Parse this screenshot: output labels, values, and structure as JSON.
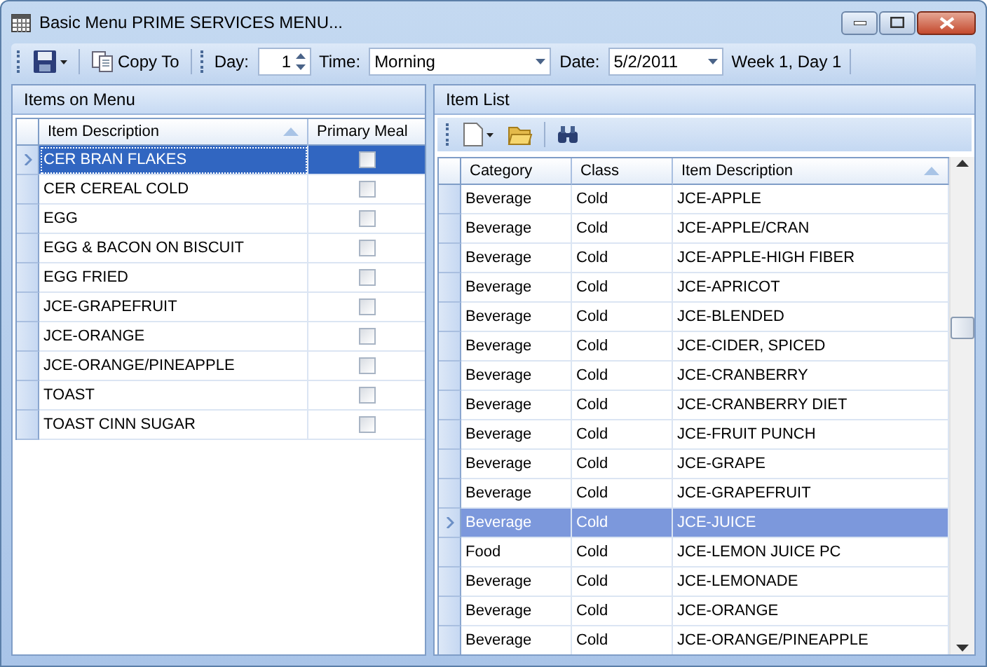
{
  "window": {
    "title": "Basic Menu PRIME SERVICES MENU..."
  },
  "toolbar": {
    "copy_to": "Copy To",
    "day_label": "Day:",
    "day_value": "1",
    "time_label": "Time:",
    "time_value": "Morning",
    "date_label": "Date:",
    "date_value": "5/2/2011",
    "week": "Week 1, Day 1"
  },
  "items_on_menu": {
    "title": "Items on Menu",
    "columns": [
      "Item Description",
      "Primary Meal"
    ],
    "rows": [
      {
        "description": "CER BRAN FLAKES",
        "primary_meal": false,
        "selected": true
      },
      {
        "description": "CER CEREAL COLD",
        "primary_meal": false,
        "selected": false
      },
      {
        "description": "EGG",
        "primary_meal": false,
        "selected": false
      },
      {
        "description": "EGG & BACON ON BISCUIT",
        "primary_meal": false,
        "selected": false
      },
      {
        "description": "EGG FRIED",
        "primary_meal": false,
        "selected": false
      },
      {
        "description": "JCE-GRAPEFRUIT",
        "primary_meal": false,
        "selected": false
      },
      {
        "description": "JCE-ORANGE",
        "primary_meal": false,
        "selected": false
      },
      {
        "description": "JCE-ORANGE/PINEAPPLE",
        "primary_meal": false,
        "selected": false
      },
      {
        "description": "TOAST",
        "primary_meal": false,
        "selected": false
      },
      {
        "description": "TOAST CINN SUGAR",
        "primary_meal": false,
        "selected": false
      }
    ]
  },
  "item_list": {
    "title": "Item List",
    "columns": [
      "Category",
      "Class",
      "Item Description"
    ],
    "rows": [
      {
        "category": "Beverage",
        "class": "Cold",
        "description": "JCE-APPLE",
        "selected": false
      },
      {
        "category": "Beverage",
        "class": "Cold",
        "description": "JCE-APPLE/CRAN",
        "selected": false
      },
      {
        "category": "Beverage",
        "class": "Cold",
        "description": "JCE-APPLE-HIGH FIBER",
        "selected": false
      },
      {
        "category": "Beverage",
        "class": "Cold",
        "description": "JCE-APRICOT",
        "selected": false
      },
      {
        "category": "Beverage",
        "class": "Cold",
        "description": "JCE-BLENDED",
        "selected": false
      },
      {
        "category": "Beverage",
        "class": "Cold",
        "description": "JCE-CIDER, SPICED",
        "selected": false
      },
      {
        "category": "Beverage",
        "class": "Cold",
        "description": "JCE-CRANBERRY",
        "selected": false
      },
      {
        "category": "Beverage",
        "class": "Cold",
        "description": "JCE-CRANBERRY DIET",
        "selected": false
      },
      {
        "category": "Beverage",
        "class": "Cold",
        "description": "JCE-FRUIT PUNCH",
        "selected": false
      },
      {
        "category": "Beverage",
        "class": "Cold",
        "description": "JCE-GRAPE",
        "selected": false
      },
      {
        "category": "Beverage",
        "class": "Cold",
        "description": "JCE-GRAPEFRUIT",
        "selected": false
      },
      {
        "category": "Beverage",
        "class": "Cold",
        "description": "JCE-JUICE",
        "selected": true
      },
      {
        "category": "Food",
        "class": "Cold",
        "description": "JCE-LEMON JUICE PC",
        "selected": false
      },
      {
        "category": "Beverage",
        "class": "Cold",
        "description": "JCE-LEMONADE",
        "selected": false
      },
      {
        "category": "Beverage",
        "class": "Cold",
        "description": "JCE-ORANGE",
        "selected": false
      },
      {
        "category": "Beverage",
        "class": "Cold",
        "description": "JCE-ORANGE/PINEAPPLE",
        "selected": false
      }
    ]
  }
}
